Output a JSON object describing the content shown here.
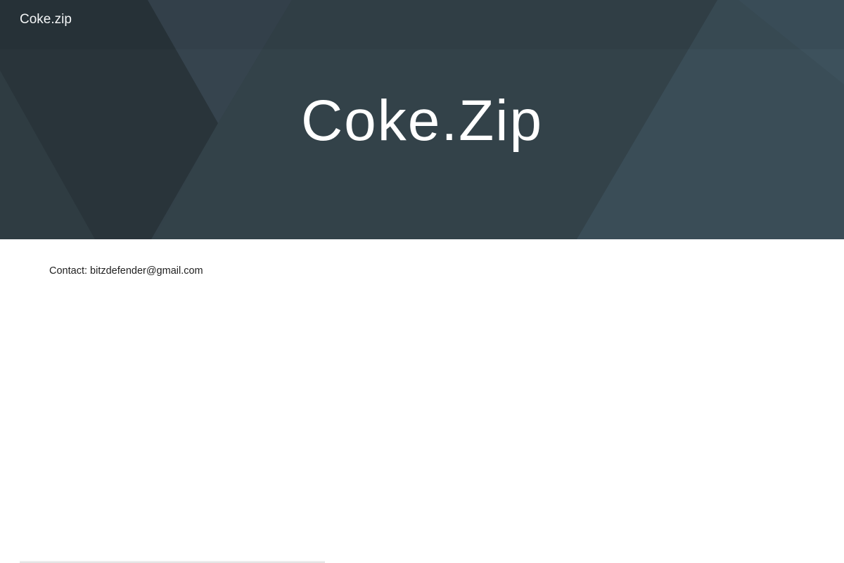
{
  "header": {
    "site_title": "Coke.zip"
  },
  "hero": {
    "title": "Coke.Zip"
  },
  "content": {
    "contact_label": "Contact: ",
    "contact_email": "bitzdefender@gmail.com"
  },
  "colors": {
    "hero_dark": "#2b363d",
    "hero_mid": "#33424a",
    "hero_light": "#3b4e58",
    "text_light": "#ffffff",
    "text_dark": "#212121",
    "background": "#ffffff"
  }
}
